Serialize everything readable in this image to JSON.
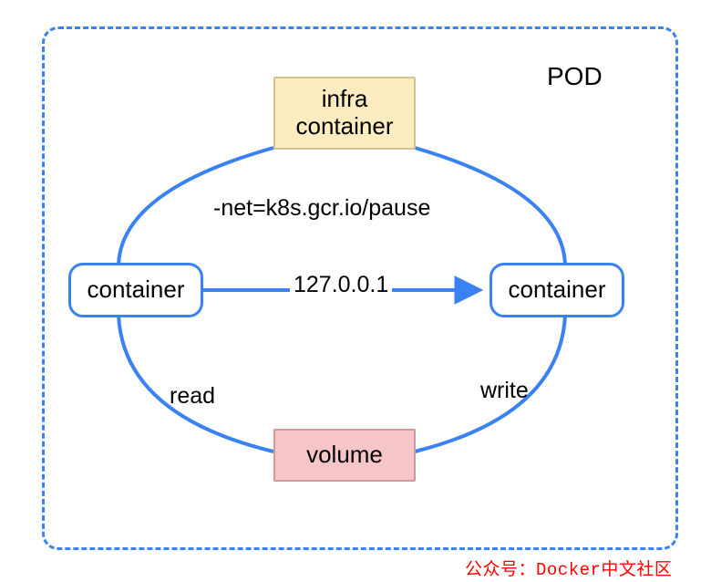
{
  "pod": {
    "label": "POD"
  },
  "nodes": {
    "infra": {
      "line1": "infra",
      "line2": "container"
    },
    "containerLeft": {
      "label": "container"
    },
    "containerRight": {
      "label": "container"
    },
    "volume": {
      "label": "volume"
    }
  },
  "edges": {
    "net": {
      "label": "-net=k8s.gcr.io/pause"
    },
    "localhost": {
      "label": "127.0.0.1"
    },
    "read": {
      "label": "read"
    },
    "write": {
      "label": "write"
    }
  },
  "footer": {
    "text": "公众号：Docker中文社区"
  },
  "colors": {
    "blue": "#3a82f3",
    "infraFill": "#fcecbf",
    "volumeFill": "#f6c5c8",
    "red": "#ff0000"
  }
}
